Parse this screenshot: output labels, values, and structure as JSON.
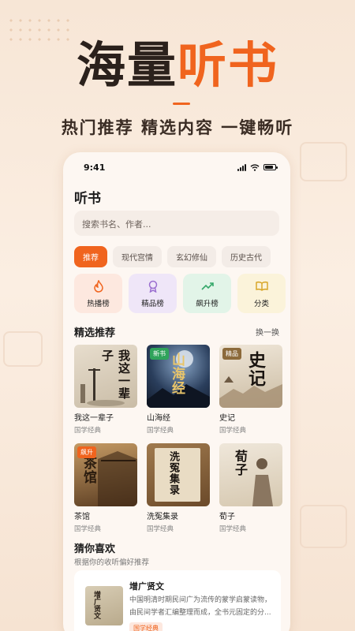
{
  "hero": {
    "title_dark": "海量",
    "title_accent": "听书",
    "subtitle": "热门推荐 精选内容 一键畅听"
  },
  "status_bar": {
    "time": "9:41"
  },
  "page": {
    "title": "听书"
  },
  "search": {
    "placeholder": "搜索书名、作者..."
  },
  "tabs": [
    {
      "label": "推荐",
      "active": true
    },
    {
      "label": "现代宫情",
      "active": false
    },
    {
      "label": "玄幻修仙",
      "active": false
    },
    {
      "label": "历史古代",
      "active": false
    }
  ],
  "categories": [
    {
      "label": "热播榜",
      "icon": "flame-icon"
    },
    {
      "label": "精品榜",
      "icon": "ribbon-award-icon"
    },
    {
      "label": "飙升榜",
      "icon": "trending-up-icon"
    },
    {
      "label": "分类",
      "icon": "open-book-icon"
    }
  ],
  "featured": {
    "title": "精选推荐",
    "more": "换一换",
    "books": [
      {
        "name": "我这一辈子",
        "genre": "国学经典",
        "cover_text": "我这一辈子",
        "badge": ""
      },
      {
        "name": "山海经",
        "genre": "国学经典",
        "cover_text": "山海经",
        "badge": "新书",
        "badge_color": "#2fa35b"
      },
      {
        "name": "史记",
        "genre": "国学经典",
        "cover_text": "史记",
        "badge": "精品",
        "badge_color": "#8c6a3b"
      },
      {
        "name": "茶馆",
        "genre": "国学经典",
        "cover_text": "茶馆",
        "badge": "飙升",
        "badge_color": "#f0641e"
      },
      {
        "name": "洗冤集录",
        "genre": "国学经典",
        "cover_text": "洗冤集录",
        "badge": ""
      },
      {
        "name": "荀子",
        "genre": "国学经典",
        "cover_text": "荀子",
        "badge": ""
      }
    ]
  },
  "guess": {
    "title": "猜你喜欢",
    "subtitle": "根据你的收听偏好推荐",
    "item": {
      "title": "增广贤文",
      "desc": "中国明清时期民间广为流传的蒙学启蒙读物，由民间学者汇编整理而成，全书元固定的分...",
      "tag": "国学经典",
      "cover_text": "增广贤文"
    }
  },
  "colors": {
    "accent": "#f0641e",
    "dark": "#2b211c"
  }
}
